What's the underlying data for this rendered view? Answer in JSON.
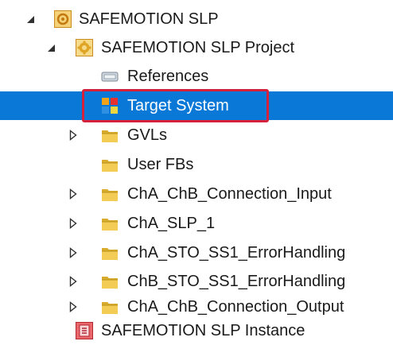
{
  "tree": {
    "root_label": "SAFEMOTION SLP",
    "project_label": "SAFEMOTION SLP Project",
    "references_label": "References",
    "target_system_label": "Target System",
    "gvls_label": "GVLs",
    "user_fbs_label": "User FBs",
    "cha_chb_input_label": "ChA_ChB_Connection_Input",
    "cha_slp_label": "ChA_SLP_1",
    "cha_sto_label": "ChA_STO_SS1_ErrorHandling",
    "chb_sto_label": "ChB_STO_SS1_ErrorHandling",
    "cha_chb_output_label": "ChA_ChB_Connection_Output",
    "instance_label": "SAFEMOTION SLP Instance"
  },
  "colors": {
    "selection": "#0a78d7",
    "highlight_border": "#d5213b",
    "folder": "#e8c24a"
  },
  "icons": {
    "expanded": "triangle-expanded-icon",
    "collapsed": "triangle-collapsed-icon",
    "folder": "folder-icon",
    "project": "gear-project-icon",
    "references": "references-icon",
    "target_system": "target-system-icon",
    "instance": "instance-icon"
  }
}
